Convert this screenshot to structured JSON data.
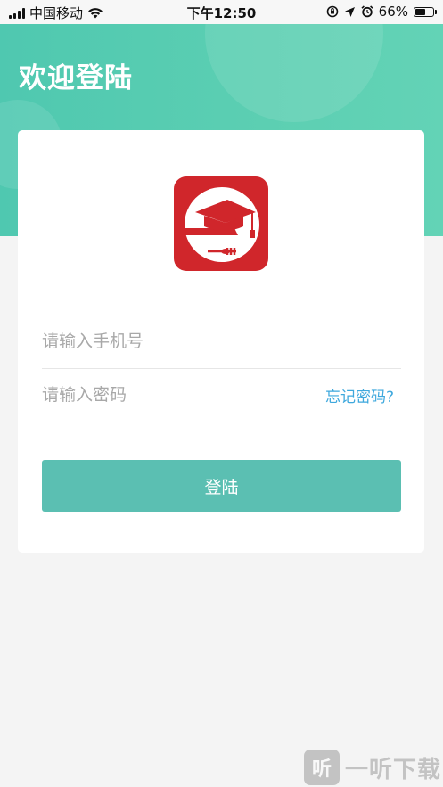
{
  "status_bar": {
    "carrier": "中国移动",
    "time": "下午12:50",
    "battery_percent": "66%",
    "battery_level": 0.66,
    "icons": [
      "signal-icon",
      "wifi-icon",
      "orientation-lock-icon",
      "location-icon",
      "alarm-icon",
      "battery-icon"
    ]
  },
  "header": {
    "title": "欢迎登陆",
    "gradient": [
      "#4fc8b0",
      "#63d3b6"
    ]
  },
  "logo": {
    "icon": "graduation-cap-plate-logo",
    "colors": {
      "red": "#d0262b",
      "white": "#ffffff"
    }
  },
  "form": {
    "phone_placeholder": "请输入手机号",
    "password_placeholder": "请输入密码",
    "forgot_label": "忘记密码?",
    "submit_label": "登陆"
  },
  "watermark": {
    "badge": "听",
    "text": "一听下载"
  },
  "colors": {
    "accent": "#5bbfb2",
    "link": "#3ea8dd",
    "background": "#f4f4f4"
  }
}
